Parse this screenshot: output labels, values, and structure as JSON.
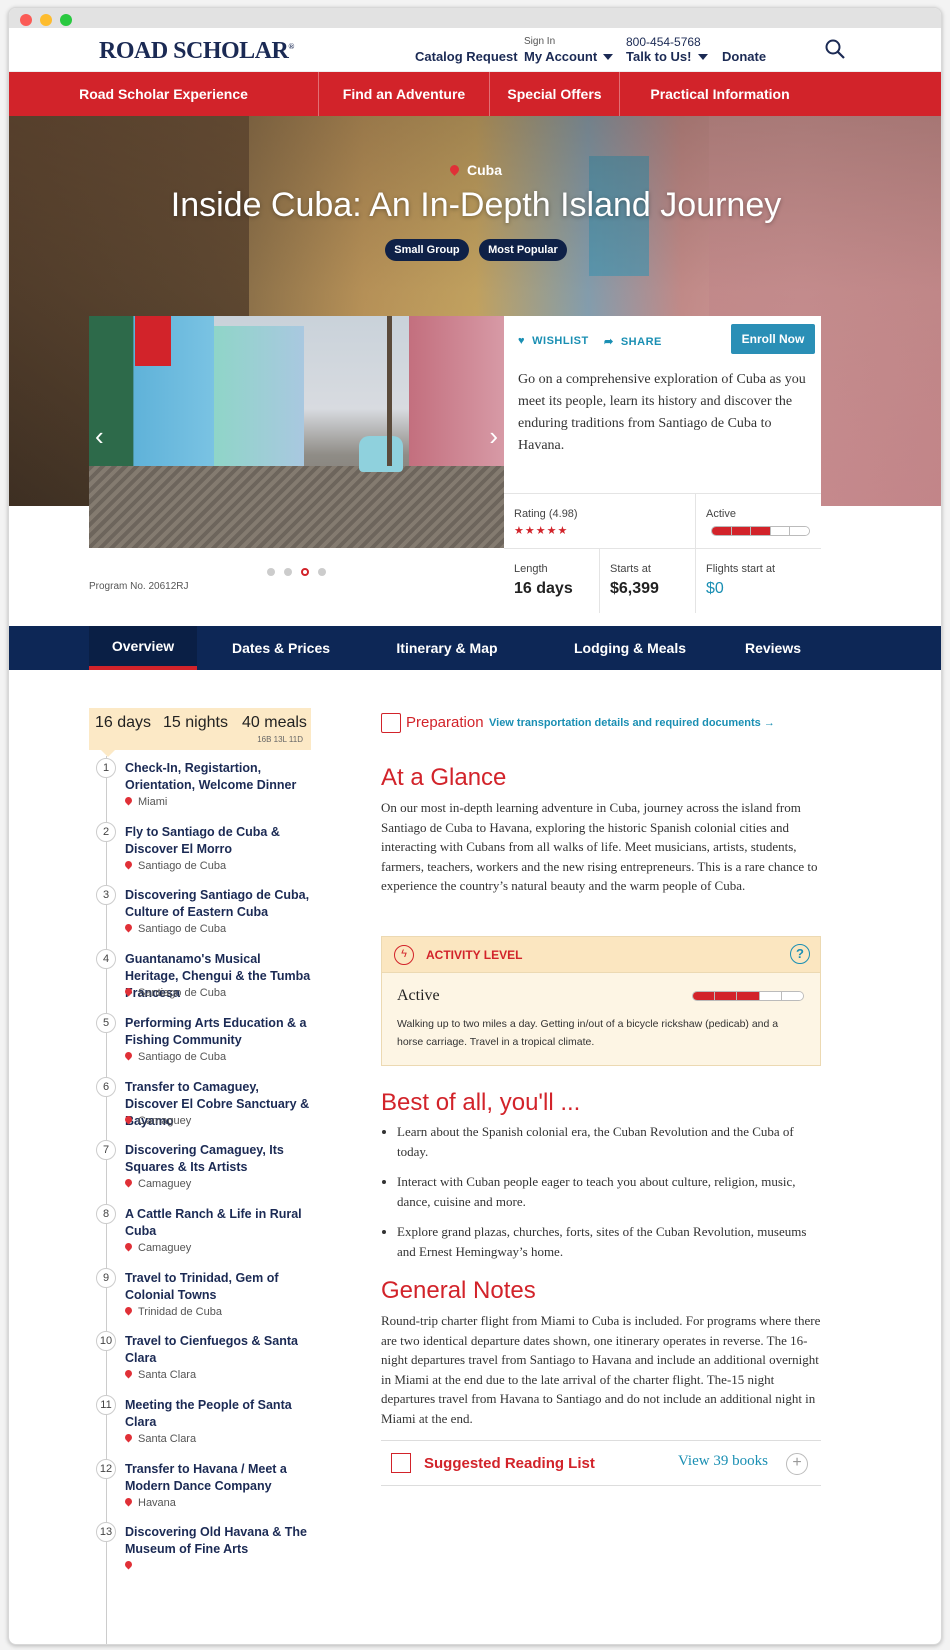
{
  "header": {
    "logo": "ROAD SCHOLAR",
    "catalog_request": "Catalog Request",
    "sign_in": "Sign In",
    "my_account": "My Account",
    "phone": "800-454-5768",
    "talk_to_us": "Talk to Us!",
    "donate": "Donate"
  },
  "nav": [
    "Road Scholar Experience",
    "Find an Adventure",
    "Special Offers",
    "Practical Information"
  ],
  "hero": {
    "location": "Cuba",
    "title": "Inside Cuba: An In-Depth Island Journey",
    "tags": [
      "Small Group",
      "Most Popular"
    ],
    "program_no": "Program No. 20612RJ",
    "carousel": {
      "count": 4,
      "active_index": 2
    }
  },
  "info": {
    "wishlist": "WISHLIST",
    "share": "SHARE",
    "enroll": "Enroll Now",
    "description": "Go on a comprehensive exploration of Cuba as you meet its people, learn its history and discover the enduring traditions from Santiago de Cuba to Havana.",
    "rating_label": "Rating (4.98)",
    "rating_stars": "★★★★★",
    "active_label": "Active",
    "active_level": 3,
    "active_max": 5,
    "length_label": "Length",
    "length_value": "16 days",
    "starts_label": "Starts at",
    "starts_value": "$6,399",
    "flights_label": "Flights start at",
    "flights_value": "$0"
  },
  "tabs": [
    "Overview",
    "Dates & Prices",
    "Itinerary & Map",
    "Lodging & Meals",
    "Reviews"
  ],
  "summary": {
    "days": "16 days",
    "nights": "15 nights",
    "meals": "40 meals",
    "meals_detail": "16B 13L 11D"
  },
  "itinerary": [
    {
      "num": "1",
      "title": "Check-In, Registartion, Orientation, Welcome Dinner",
      "place": "Miami"
    },
    {
      "num": "2",
      "title": "Fly to Santiago de Cuba & Discover El Morro",
      "place": "Santiago de Cuba"
    },
    {
      "num": "3",
      "title": "Discovering Santiago de Cuba, Culture of Eastern Cuba",
      "place": "Santiago de Cuba"
    },
    {
      "num": "4",
      "title": "Guantanamo's Musical Heritage, Chengui & the Tumba Francesa",
      "place": "Santiago de Cuba"
    },
    {
      "num": "5",
      "title": "Performing Arts Education & a Fishing Community",
      "place": "Santiago de Cuba"
    },
    {
      "num": "6",
      "title": "Transfer to Camaguey, Discover El Cobre Sanctuary & Bayamo",
      "place": "Camaguey"
    },
    {
      "num": "7",
      "title": "Discovering Camaguey, Its Squares & Its Artists",
      "place": "Camaguey"
    },
    {
      "num": "8",
      "title": "A Cattle Ranch & Life in Rural Cuba",
      "place": "Camaguey"
    },
    {
      "num": "9",
      "title": "Travel to Trinidad, Gem of Colonial Towns",
      "place": "Trinidad de Cuba"
    },
    {
      "num": "10",
      "title": "Travel to Cienfuegos & Santa Clara",
      "place": "Santa Clara"
    },
    {
      "num": "11",
      "title": "Meeting the People of Santa Clara",
      "place": "Santa Clara"
    },
    {
      "num": "12",
      "title": "Transfer to Havana / Meet a Modern Dance Company",
      "place": "Havana"
    },
    {
      "num": "13",
      "title": "Discovering Old Havana & The Museum of Fine Arts",
      "place": ""
    }
  ],
  "preparation": {
    "title": "Preparation",
    "link": "View transportation details and required documents →"
  },
  "glance": {
    "title": "At a Glance",
    "text": "On our most in-depth learning adventure in Cuba, journey across the island from Santiago de Cuba to Havana, exploring the historic Spanish colonial cities and interacting with Cubans from all walks of life. Meet musicians, artists, students, farmers, teachers, workers and the new rising entrepreneurs. This is a rare chance to experience the country’s natural beauty and the warm people of Cuba."
  },
  "activity": {
    "heading": "ACTIVITY LEVEL",
    "level_name": "Active",
    "level": 3,
    "max": 5,
    "description": "Walking up to two miles a day. Getting in/out of a bicycle rickshaw (pedicab) and a horse carriage. Travel in a tropical climate."
  },
  "best": {
    "title": "Best of all, you'll ...",
    "items": [
      "Learn about the Spanish colonial era, the Cuban Revolution and the Cuba of today.",
      "Interact with Cuban people eager to teach you about culture, religion, music, dance, cuisine and more.",
      "Explore grand plazas, churches, forts, sites of the Cuban Revolution, museums and Ernest Hemingway’s home."
    ]
  },
  "notes": {
    "title": "General Notes",
    "text": "Round-trip charter flight from Miami to Cuba is included. For programs where there are two identical departure dates shown, one itinerary operates in reverse. The 16-night departures travel from Santiago to Havana and include an additional overnight in Miami at the end due to the late arrival of the charter flight. The-15 night departures travel from Havana to Santiago and do not include an additional night in Miami at the end."
  },
  "reading": {
    "title": "Suggested Reading List",
    "link": "View 39 books"
  },
  "colors": {
    "brand_red": "#d2232a",
    "navy": "#0d2756",
    "link_blue": "#1a8fb3",
    "cream": "#fdf5e4"
  }
}
